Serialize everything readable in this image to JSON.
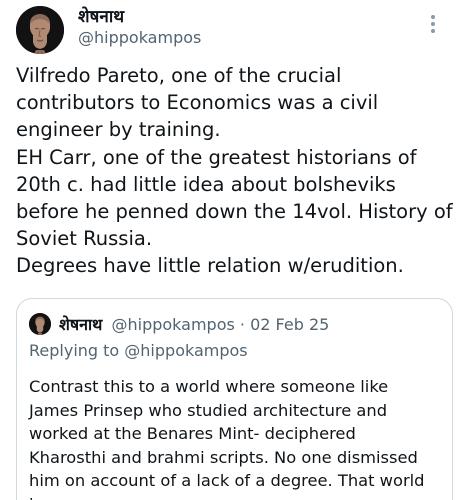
{
  "tweet": {
    "author": {
      "name": "शेषनाथ",
      "handle": "@hippokampos"
    },
    "text": "Vilfredo Pareto, one of the crucial contributors to Economics was a civil engineer by training.\nEH Carr, one of the greatest historians of 20th c. had little idea about bolsheviks before he penned down the 14vol. History of Soviet Russia.\nDegrees have little relation w/erudition."
  },
  "quoted_tweet": {
    "author": {
      "name": "शेषनाथ",
      "handle": "@hippokampos"
    },
    "date_separator": "·",
    "date": "02 Feb 25",
    "reply_context": "Replying to @hippokampos",
    "text": "Contrast this to a world where someone like\nJames Prinsep who studied architecture and\nworked at the Benares Mint- deciphered\nKharosthi and brahmi scripts. No one dismissed\nhim on account of a lack of a degree. That world i..."
  },
  "icons": {
    "more": "more-vertical-icon",
    "avatar": "sculpture-head-avatar"
  },
  "colors": {
    "text_primary": "#0f1419",
    "text_secondary": "#536471",
    "border": "#cfd9de",
    "icon": "#8b98a5"
  }
}
